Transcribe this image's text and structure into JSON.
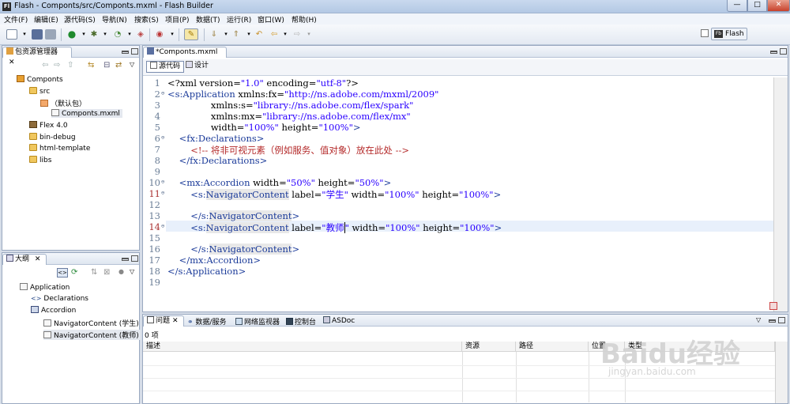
{
  "window": {
    "title": "Flash - Componts/src/Componts.mxml - Flash Builder",
    "app_icon": "Fl",
    "minimize": "—",
    "maximize": "□",
    "close": "✕"
  },
  "menubar": {
    "items": [
      "文件(F)",
      "编辑(E)",
      "源代码(S)",
      "导航(N)",
      "搜索(S)",
      "项目(P)",
      "数据(T)",
      "运行(R)",
      "窗口(W)",
      "帮助(H)"
    ]
  },
  "toolbar": {
    "perspective_label": "Flash",
    "perspective_icon": "Fb"
  },
  "package_explorer": {
    "tab_label": "包资源管理器",
    "items": [
      "Componts",
      "src",
      "（默认包）",
      "Componts.mxml",
      "Flex 4.0",
      "bin-debug",
      "html-template",
      "libs"
    ]
  },
  "outline": {
    "tab_label": "大纲",
    "items": [
      "Application",
      "Declarations",
      "Accordion",
      "NavigatorContent (学生)",
      "NavigatorContent (教师)"
    ]
  },
  "editor": {
    "tab_label": "*Componts.mxml",
    "source_tab": "源代码",
    "design_tab": "设计",
    "lines": [
      {
        "n": "1",
        "text": "<?xml version=\"1.0\" encoding=\"utf-8\"?>"
      },
      {
        "n": "2",
        "text": "<s:Application xmlns:fx=\"http://ns.adobe.com/mxml/2009\""
      },
      {
        "n": "3",
        "text": "               xmlns:s=\"library://ns.adobe.com/flex/spark\""
      },
      {
        "n": "4",
        "text": "               xmlns:mx=\"library://ns.adobe.com/flex/mx\""
      },
      {
        "n": "5",
        "text": "               width=\"100%\" height=\"100%\">"
      },
      {
        "n": "6",
        "text": "    <fx:Declarations>"
      },
      {
        "n": "7",
        "text": "        <!-- 将非可视元素（例如服务、值对象）放在此处 -->"
      },
      {
        "n": "8",
        "text": "    </fx:Declarations>"
      },
      {
        "n": "9",
        "text": ""
      },
      {
        "n": "10",
        "text": "    <mx:Accordion width=\"50%\" height=\"50%\">"
      },
      {
        "n": "11",
        "text": "        <s:NavigatorContent label=\"学生\" width=\"100%\" height=\"100%\">"
      },
      {
        "n": "12",
        "text": ""
      },
      {
        "n": "13",
        "text": "        </s:NavigatorContent>"
      },
      {
        "n": "14",
        "text": "        <s:NavigatorContent label=\"教师\" width=\"100%\" height=\"100%\">"
      },
      {
        "n": "15",
        "text": ""
      },
      {
        "n": "16",
        "text": "        </s:NavigatorContent>"
      },
      {
        "n": "17",
        "text": "    </mx:Accordion>"
      },
      {
        "n": "18",
        "text": "</s:Application>"
      },
      {
        "n": "19",
        "text": ""
      }
    ]
  },
  "bottom_panel": {
    "tabs": [
      "问题",
      "数据/服务",
      "网络监视器",
      "控制台",
      "ASDoc"
    ],
    "summary": "0 项",
    "columns": [
      "描述",
      "资源",
      "路径",
      "位置",
      "类型"
    ]
  },
  "watermark": {
    "brand": "Baidu经验",
    "url": "jingyan.baidu.com"
  }
}
